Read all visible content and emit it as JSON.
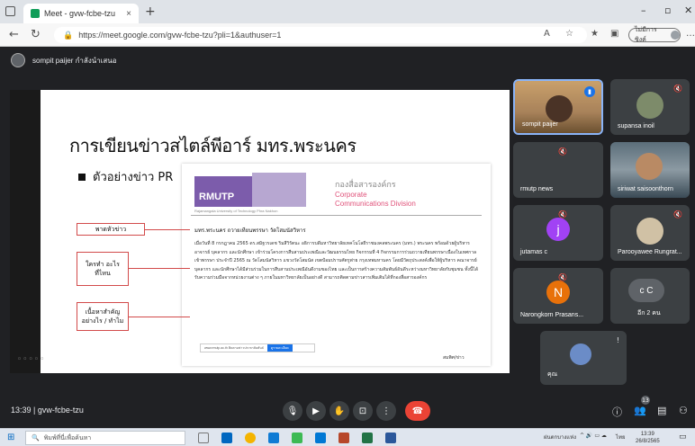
{
  "browser": {
    "tab_title": "Meet - gvw-fcbe-tzu",
    "tab_close": "×",
    "new_tab": "+",
    "url": "https://meet.google.com/gvw-fcbe-tzu?pli=1&authuser=1",
    "profile_label": "ไม่มีการซิงค์"
  },
  "meet": {
    "presenter_text": "sompit paijer กำลังนำเสนอ",
    "meeting_time": "13:39",
    "meeting_code": "gvw-fcbe-tzu",
    "participants_badge": "13"
  },
  "slide": {
    "title": "การเขียนข่าวสไตล์พีอาร์ มทร.พระนคร",
    "bullet": "ตัวอย่างข่าว PR",
    "doc": {
      "logo": "RMUTP",
      "org_th": "กองสื่อสารองค์กร",
      "org_en_1": "Corporate",
      "org_en_2": "Communications Division",
      "subline": "Rajamangala University of Technology Phra Nakhon",
      "headline": "มทร.พระนคร ถวายเทียนพรรษา วัดโสมนัสวิหาร",
      "body": "เมื่อวันที่ 8 กรกฎาคม 2565 ดร.สมิฐวรเดช ริมสีวิรัตนะ อธิการบดีมหาวิทยาลัยเทคโนโลยีราชมงคลพระนคร (มทร.) พระนคร พร้อมด้วยผู้บริหาร อาจารย์ บุคลากร และนักศึกษา เข้าร่วมโครงการสืบสานประเพณีและวัฒนธรรมไทย กิจกรรมที่ 4 กิจกรรมการร่วมถวายเทียนพรรษาเนื่องในเทศกาลเข้าพรรษา ประจำปี 2565 ณ วัดโสมนัสวิหาร แขวงวัดโสมนัส เขตป้อมปราบศัตรูพ่าย กรุงเทพมหานคร โดยมีวัตถุประสงค์เพื่อให้ผู้บริหาร คณาจารย์ บุคลากร และนักศึกษาได้มีส่วนร่วมในการสืบสานประเพณีอันดีงามของไทย และเป็นการสร้างความสัมพันธ์อันดีระหว่างมหาวิทยาลัยกับชุมชน ทั้งนี้ได้รับความร่วมมือจากหน่วยงานต่าง ๆ ภายในมหาวิทยาลัยเป็นอย่างดี สามารถติดตามข่าวสารเพิ่มเติมได้ที่กองสื่อสารองค์กร",
      "link_text": "www.rmutp.ac.th ติดตามข่าวประชาสัมพันธ์",
      "link_button": "ดูรายละเอียด",
      "signature": "สมพิศ/ข่าว"
    },
    "callouts": [
      "พาดหัวข่าว",
      "ใครทำ อะไร ที่ไหน",
      "เนื้อหาสำคัญ อย่างไร / ทำไม"
    ]
  },
  "participants": [
    {
      "name": "sompit paijer"
    },
    {
      "name": "supansa inoil"
    },
    {
      "name": "rmutp news"
    },
    {
      "name": "siriwat saisoonthorn"
    },
    {
      "name": "jutamas c",
      "initial": "j"
    },
    {
      "name": "Parooyawee Rungrat..."
    },
    {
      "name": "Narongkorn Prasans...",
      "initial": "N"
    },
    {
      "name": "อีก 2 คน",
      "initials": "c C"
    },
    {
      "name": "คุณ"
    }
  ],
  "taskbar": {
    "search_placeholder": "พิมพ์ที่นี่เพื่อค้นหา",
    "weather": "ฝนตกบางแห่ง",
    "lang": "ไทย",
    "time": "13:39",
    "date": "26/8/2565"
  }
}
